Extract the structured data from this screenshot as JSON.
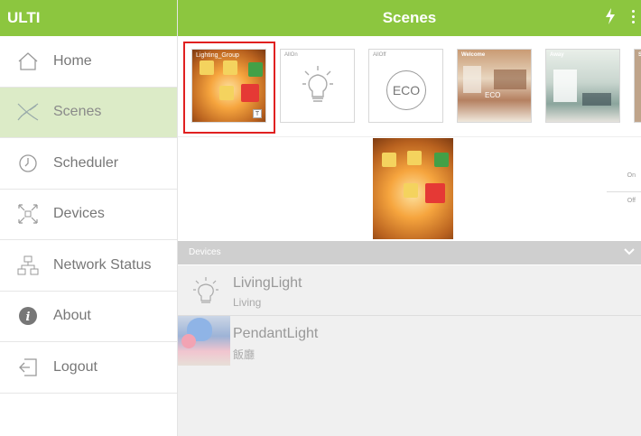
{
  "app": {
    "brand": "ULTI"
  },
  "header": {
    "title": "Scenes"
  },
  "sidebar": {
    "items": [
      {
        "label": "Home",
        "icon": "home-icon"
      },
      {
        "label": "Scenes",
        "icon": "scenes-icon",
        "active": true
      },
      {
        "label": "Scheduler",
        "icon": "clock-icon"
      },
      {
        "label": "Devices",
        "icon": "devices-icon"
      },
      {
        "label": "Network Status",
        "icon": "network-icon"
      },
      {
        "label": "About",
        "icon": "info-icon"
      },
      {
        "label": "Logout",
        "icon": "logout-icon"
      }
    ]
  },
  "scenes": {
    "items": [
      {
        "label": "Lighting_Group",
        "selected": true
      },
      {
        "label": "AllOn"
      },
      {
        "label": "AllOff",
        "icon_text": "ECO"
      },
      {
        "label": "Welcome",
        "overlay": "ECO"
      },
      {
        "label": "Away"
      },
      {
        "label": "S"
      }
    ],
    "badge": "T"
  },
  "preview": {
    "on_label": "On",
    "off_label": "Off"
  },
  "devices": {
    "header": "Devices",
    "items": [
      {
        "name": "LivingLight",
        "room": "Living"
      },
      {
        "name": "PendantLight",
        "room": "飯廳"
      }
    ]
  },
  "colors": {
    "accent": "#8cc63f",
    "active_bg": "#dcebc7",
    "selected_border": "#e02020"
  }
}
